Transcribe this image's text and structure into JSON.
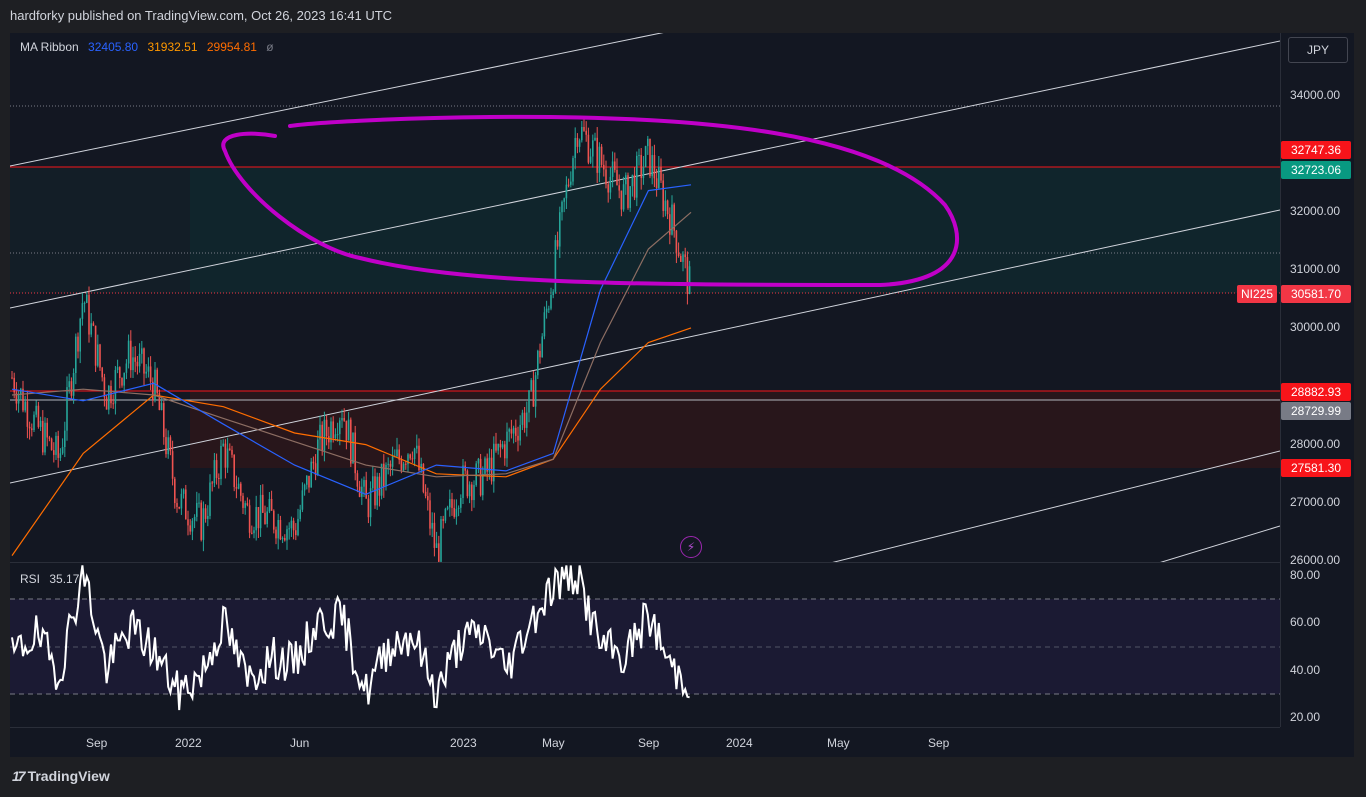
{
  "header": {
    "publisher": "hardforky published on TradingView.com, Oct 26, 2023 16:41 UTC"
  },
  "legend": {
    "name": "MA Ribbon",
    "v1": "32405.80",
    "v2": "31932.51",
    "v3": "29954.81",
    "symbol": "ø"
  },
  "rsi_legend": {
    "name": "RSI",
    "value": "35.17"
  },
  "currency_button": "JPY",
  "symbol_tag": "NI225",
  "price_tags": [
    {
      "label": "32747.36",
      "color": "#f7141a"
    },
    {
      "label": "32723.06",
      "color": "#089981"
    },
    {
      "label": "30581.70",
      "color": "#f23645"
    },
    {
      "label": "28882.93",
      "color": "#f7141a"
    },
    {
      "label": "28729.99",
      "color": "#787b86"
    },
    {
      "label": "27581.30",
      "color": "#f7141a"
    }
  ],
  "footer": {
    "brand": "TradingView",
    "logo": "tradingview-logo-icon"
  },
  "colors": {
    "ma_fast": "#2962ff",
    "ma_mid": "#8d6e63",
    "ma_slow": "#ff6d00",
    "annotation": "#c000c8",
    "rsi_line": "#ffffff",
    "up": "#26a69a",
    "down": "#ef5350"
  },
  "chart_data": [
    {
      "type": "line",
      "panel": "price",
      "y_ticks": [
        26000,
        27000,
        28000,
        30000,
        31000,
        32000,
        34000
      ],
      "y_tick_labels": [
        "26000.00",
        "27000.00",
        "28000.00",
        "30000.00",
        "31000.00",
        "32000.00",
        "34000.00"
      ],
      "ylim": [
        25940,
        35000
      ],
      "x_tick_labels": [
        "Sep",
        "2022",
        "Jun",
        "2023",
        "May",
        "Sep",
        "2024",
        "May",
        "Sep"
      ],
      "series": [
        {
          "key": "price",
          "x": [
            "2021-06",
            "2021-07",
            "2021-08",
            "2021-09",
            "2021-10",
            "2021-11",
            "2021-12",
            "2022-01",
            "2022-02",
            "2022-03",
            "2022-04",
            "2022-05",
            "2022-06",
            "2022-07",
            "2022-08",
            "2022-09",
            "2022-10",
            "2022-11",
            "2022-12",
            "2023-01",
            "2023-02",
            "2023-03",
            "2023-04",
            "2023-05",
            "2023-06",
            "2023-07",
            "2023-08",
            "2023-09",
            "2023-10",
            "2023-10-26"
          ],
          "y": [
            29100,
            28300,
            27700,
            30500,
            28800,
            29500,
            29000,
            27000,
            26600,
            27900,
            26800,
            26700,
            26500,
            27900,
            28600,
            26900,
            27500,
            28000,
            26100,
            27300,
            27400,
            28000,
            28600,
            30900,
            33400,
            32800,
            32200,
            32900,
            31800,
            30580
          ]
        },
        {
          "key": "ma_fast",
          "x": [
            "2021-06",
            "2021-09",
            "2021-12",
            "2022-03",
            "2022-06",
            "2022-09",
            "2022-12",
            "2023-03",
            "2023-05",
            "2023-07",
            "2023-09",
            "2023-10-26"
          ],
          "y": [
            28900,
            28700,
            29000,
            28300,
            27600,
            27100,
            27600,
            27500,
            27800,
            30600,
            32300,
            32400
          ]
        },
        {
          "key": "ma_mid",
          "x": [
            "2021-06",
            "2021-09",
            "2021-12",
            "2022-03",
            "2022-06",
            "2022-09",
            "2022-12",
            "2023-03",
            "2023-05",
            "2023-07",
            "2023-09",
            "2023-10-26"
          ],
          "y": [
            28800,
            28900,
            28800,
            28400,
            28000,
            27600,
            27400,
            27450,
            27700,
            29700,
            31300,
            31930
          ]
        },
        {
          "key": "ma_slow",
          "x": [
            "2021-06",
            "2021-09",
            "2021-12",
            "2022-03",
            "2022-06",
            "2022-09",
            "2022-12",
            "2023-03",
            "2023-05",
            "2023-07",
            "2023-09",
            "2023-10-26"
          ],
          "y": [
            26050,
            27800,
            28800,
            28600,
            28150,
            27950,
            27450,
            27400,
            27700,
            28900,
            29700,
            29950
          ]
        }
      ]
    },
    {
      "type": "line",
      "panel": "rsi",
      "title": "RSI",
      "y_ticks": [
        20,
        40,
        60,
        80
      ],
      "y_tick_labels": [
        "20.00",
        "40.00",
        "60.00",
        "80.00"
      ],
      "ylim": [
        15,
        85
      ],
      "x": [
        "2021-06",
        "2021-07",
        "2021-08",
        "2021-09",
        "2021-10",
        "2021-11",
        "2021-12",
        "2022-01",
        "2022-02",
        "2022-03",
        "2022-04",
        "2022-05",
        "2022-06",
        "2022-07",
        "2022-08",
        "2022-09",
        "2022-10",
        "2022-11",
        "2022-12",
        "2023-01",
        "2023-02",
        "2023-03",
        "2023-04",
        "2023-05",
        "2023-06",
        "2023-07",
        "2023-08",
        "2023-09",
        "2023-10",
        "2023-10-26"
      ],
      "y": [
        45,
        55,
        38,
        82,
        40,
        58,
        48,
        30,
        38,
        60,
        35,
        45,
        42,
        60,
        62,
        30,
        50,
        55,
        30,
        52,
        55,
        40,
        60,
        76,
        80,
        50,
        45,
        63,
        40,
        35.17
      ]
    }
  ]
}
